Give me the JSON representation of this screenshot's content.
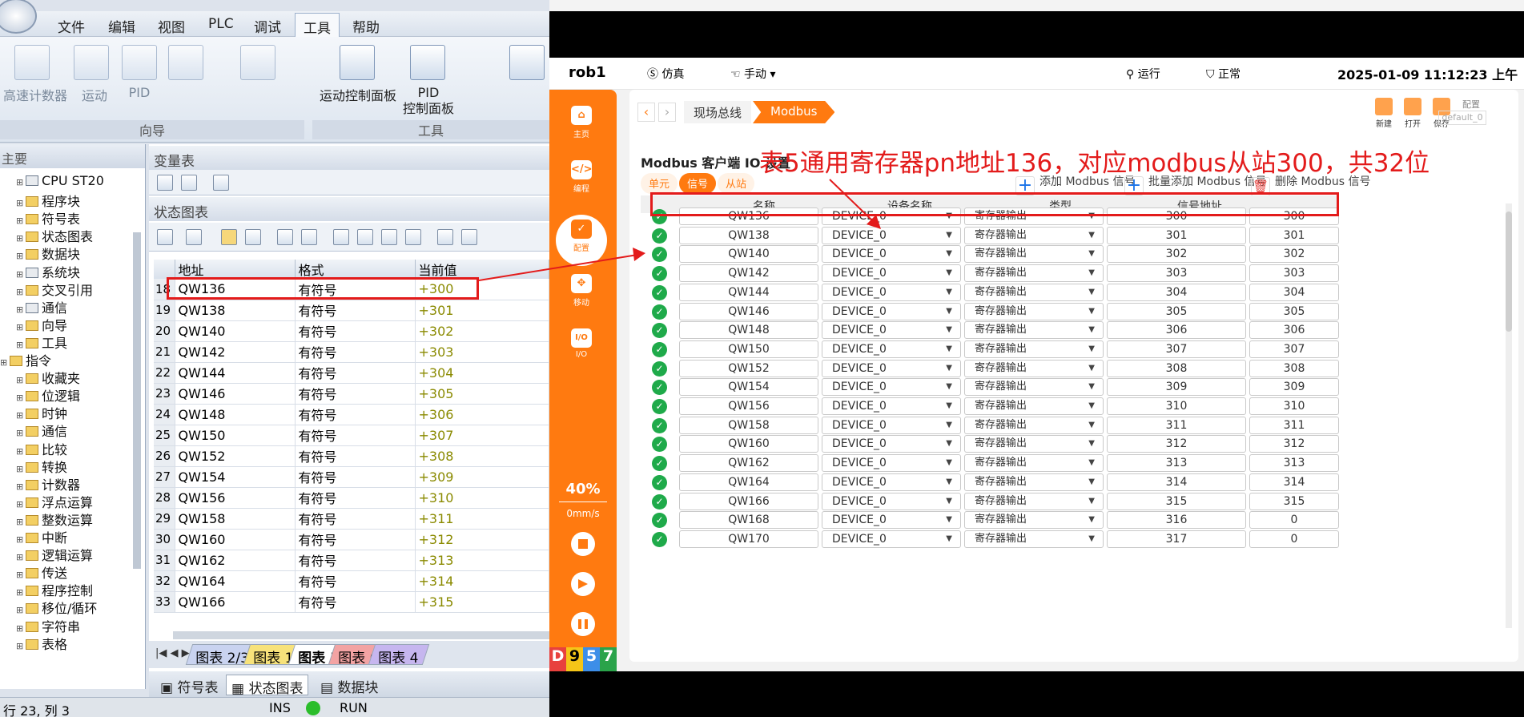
{
  "plc": {
    "menu": [
      "文件",
      "编辑",
      "视图",
      "PLC",
      "调试",
      "工具",
      "帮助"
    ],
    "ribbon": {
      "left_items": [
        "高速计数器",
        "运动",
        "PID"
      ],
      "right_items": [
        "运动控制面板",
        "PID\n控制面板"
      ],
      "groups": [
        "向导",
        "工具"
      ]
    },
    "left_pane_title": "主要",
    "tree": [
      {
        "label": "CPU ST20",
        "icon": "cpu-icon",
        "level": 1
      },
      {
        "label": "程序块",
        "icon": "folder-icon",
        "level": 1
      },
      {
        "label": "符号表",
        "icon": "folder-icon",
        "level": 1
      },
      {
        "label": "状态图表",
        "icon": "folder-icon",
        "level": 1
      },
      {
        "label": "数据块",
        "icon": "folder-icon",
        "level": 1
      },
      {
        "label": "系统块",
        "icon": "system-block-icon",
        "level": 1
      },
      {
        "label": "交叉引用",
        "icon": "folder-icon",
        "level": 1
      },
      {
        "label": "通信",
        "icon": "network-icon",
        "level": 1
      },
      {
        "label": "向导",
        "icon": "wizard-icon",
        "level": 1
      },
      {
        "label": "工具",
        "icon": "folder-icon",
        "level": 1
      },
      {
        "label": "指令",
        "icon": "folder-icon",
        "level": 0
      },
      {
        "label": "收藏夹",
        "icon": "folder-icon",
        "level": 1
      },
      {
        "label": "位逻辑",
        "icon": "folder-icon",
        "level": 1
      },
      {
        "label": "时钟",
        "icon": "clock-icon",
        "level": 1
      },
      {
        "label": "通信",
        "icon": "folder-icon",
        "level": 1
      },
      {
        "label": "比较",
        "icon": "folder-icon",
        "level": 1
      },
      {
        "label": "转换",
        "icon": "folder-icon",
        "level": 1
      },
      {
        "label": "计数器",
        "icon": "folder-icon",
        "level": 1
      },
      {
        "label": "浮点运算",
        "icon": "folder-icon",
        "level": 1
      },
      {
        "label": "整数运算",
        "icon": "folder-icon",
        "level": 1
      },
      {
        "label": "中断",
        "icon": "folder-icon",
        "level": 1
      },
      {
        "label": "逻辑运算",
        "icon": "folder-icon",
        "level": 1
      },
      {
        "label": "传送",
        "icon": "folder-icon",
        "level": 1
      },
      {
        "label": "程序控制",
        "icon": "folder-icon",
        "level": 1
      },
      {
        "label": "移位/循环",
        "icon": "folder-icon",
        "level": 1
      },
      {
        "label": "字符串",
        "icon": "folder-icon",
        "level": 1
      },
      {
        "label": "表格",
        "icon": "folder-icon",
        "level": 1
      }
    ],
    "var_table_title": "变量表",
    "status_chart_title": "状态图表",
    "table_headers": [
      "地址",
      "格式",
      "当前值"
    ],
    "rows": [
      {
        "n": "18",
        "addr": "QW136",
        "fmt": "有符号",
        "val": "+300"
      },
      {
        "n": "19",
        "addr": "QW138",
        "fmt": "有符号",
        "val": "+301"
      },
      {
        "n": "20",
        "addr": "QW140",
        "fmt": "有符号",
        "val": "+302"
      },
      {
        "n": "21",
        "addr": "QW142",
        "fmt": "有符号",
        "val": "+303"
      },
      {
        "n": "22",
        "addr": "QW144",
        "fmt": "有符号",
        "val": "+304"
      },
      {
        "n": "23",
        "addr": "QW146",
        "fmt": "有符号",
        "val": "+305"
      },
      {
        "n": "24",
        "addr": "QW148",
        "fmt": "有符号",
        "val": "+306"
      },
      {
        "n": "25",
        "addr": "QW150",
        "fmt": "有符号",
        "val": "+307"
      },
      {
        "n": "26",
        "addr": "QW152",
        "fmt": "有符号",
        "val": "+308"
      },
      {
        "n": "27",
        "addr": "QW154",
        "fmt": "有符号",
        "val": "+309"
      },
      {
        "n": "28",
        "addr": "QW156",
        "fmt": "有符号",
        "val": "+310"
      },
      {
        "n": "29",
        "addr": "QW158",
        "fmt": "有符号",
        "val": "+311"
      },
      {
        "n": "30",
        "addr": "QW160",
        "fmt": "有符号",
        "val": "+312"
      },
      {
        "n": "31",
        "addr": "QW162",
        "fmt": "有符号",
        "val": "+313"
      },
      {
        "n": "32",
        "addr": "QW164",
        "fmt": "有符号",
        "val": "+314"
      },
      {
        "n": "33",
        "addr": "QW166",
        "fmt": "有符号",
        "val": "+315"
      }
    ],
    "sheet_tabs": [
      {
        "label": "图表 2/3",
        "color": "#c9d3f0"
      },
      {
        "label": "图表 1",
        "color": "#f7e27a"
      },
      {
        "label": "图表 5",
        "color": "#ffffff"
      },
      {
        "label": "图表 6",
        "color": "#f3a3a3"
      },
      {
        "label": "图表 4",
        "color": "#c6b6ef"
      }
    ],
    "bottom_tabs": [
      "符号表",
      "状态图表",
      "数据块"
    ],
    "status": {
      "pos": "行 23, 列 3",
      "mode": "INS",
      "run": "RUN"
    }
  },
  "robot": {
    "name": "rob1",
    "mode": "仿真",
    "manual": "手动",
    "run": "运行",
    "state": "正常",
    "datetime": "2025-01-09 11:12:23 上午",
    "sidebar": [
      {
        "label": "主页",
        "icon": "home-icon",
        "glyph": "⌂"
      },
      {
        "label": "编程",
        "icon": "code-icon",
        "glyph": "</>"
      },
      {
        "label": "配置",
        "icon": "config-icon",
        "glyph": "✓"
      },
      {
        "label": "移动",
        "icon": "move-icon",
        "glyph": "✥"
      },
      {
        "label": "I/O",
        "icon": "io-icon",
        "glyph": "I/O"
      }
    ],
    "speed_pct": "40%",
    "speed_val": "0mm/s",
    "badge": [
      "D",
      "9",
      "5",
      "7"
    ],
    "breadcrumb": [
      "现场总线",
      "Modbus"
    ],
    "tools": [
      "新建",
      "打开",
      "保存"
    ],
    "config_label": "配置",
    "config_value": "default_0",
    "panel_title": "Modbus 客户端 IO 设置",
    "annotation": "表5通用寄存器pn地址136，对应modbus从站300，共32位",
    "tabs": [
      "单元",
      "信号",
      "从站"
    ],
    "actions": [
      "添加 Modbus 信号",
      "批量添加 Modbus 信号",
      "删除 Modbus 信号"
    ],
    "headers": [
      "名称",
      "设备名称",
      "类型",
      "信号地址"
    ],
    "signals": [
      {
        "name": "QW136",
        "dev": "DEVICE_0",
        "type": "寄存器输出",
        "addr": "300",
        "val": "300"
      },
      {
        "name": "QW138",
        "dev": "DEVICE_0",
        "type": "寄存器输出",
        "addr": "301",
        "val": "301"
      },
      {
        "name": "QW140",
        "dev": "DEVICE_0",
        "type": "寄存器输出",
        "addr": "302",
        "val": "302"
      },
      {
        "name": "QW142",
        "dev": "DEVICE_0",
        "type": "寄存器输出",
        "addr": "303",
        "val": "303"
      },
      {
        "name": "QW144",
        "dev": "DEVICE_0",
        "type": "寄存器输出",
        "addr": "304",
        "val": "304"
      },
      {
        "name": "QW146",
        "dev": "DEVICE_0",
        "type": "寄存器输出",
        "addr": "305",
        "val": "305"
      },
      {
        "name": "QW148",
        "dev": "DEVICE_0",
        "type": "寄存器输出",
        "addr": "306",
        "val": "306"
      },
      {
        "name": "QW150",
        "dev": "DEVICE_0",
        "type": "寄存器输出",
        "addr": "307",
        "val": "307"
      },
      {
        "name": "QW152",
        "dev": "DEVICE_0",
        "type": "寄存器输出",
        "addr": "308",
        "val": "308"
      },
      {
        "name": "QW154",
        "dev": "DEVICE_0",
        "type": "寄存器输出",
        "addr": "309",
        "val": "309"
      },
      {
        "name": "QW156",
        "dev": "DEVICE_0",
        "type": "寄存器输出",
        "addr": "310",
        "val": "310"
      },
      {
        "name": "QW158",
        "dev": "DEVICE_0",
        "type": "寄存器输出",
        "addr": "311",
        "val": "311"
      },
      {
        "name": "QW160",
        "dev": "DEVICE_0",
        "type": "寄存器输出",
        "addr": "312",
        "val": "312"
      },
      {
        "name": "QW162",
        "dev": "DEVICE_0",
        "type": "寄存器输出",
        "addr": "313",
        "val": "313"
      },
      {
        "name": "QW164",
        "dev": "DEVICE_0",
        "type": "寄存器输出",
        "addr": "314",
        "val": "314"
      },
      {
        "name": "QW166",
        "dev": "DEVICE_0",
        "type": "寄存器输出",
        "addr": "315",
        "val": "315"
      },
      {
        "name": "QW168",
        "dev": "DEVICE_0",
        "type": "寄存器输出",
        "addr": "316",
        "val": "0"
      },
      {
        "name": "QW170",
        "dev": "DEVICE_0",
        "type": "寄存器输出",
        "addr": "317",
        "val": "0"
      }
    ]
  },
  "colors": {
    "accent": "#ff7a10",
    "highlight": "#e31b1b",
    "ok": "#1faa4a"
  }
}
